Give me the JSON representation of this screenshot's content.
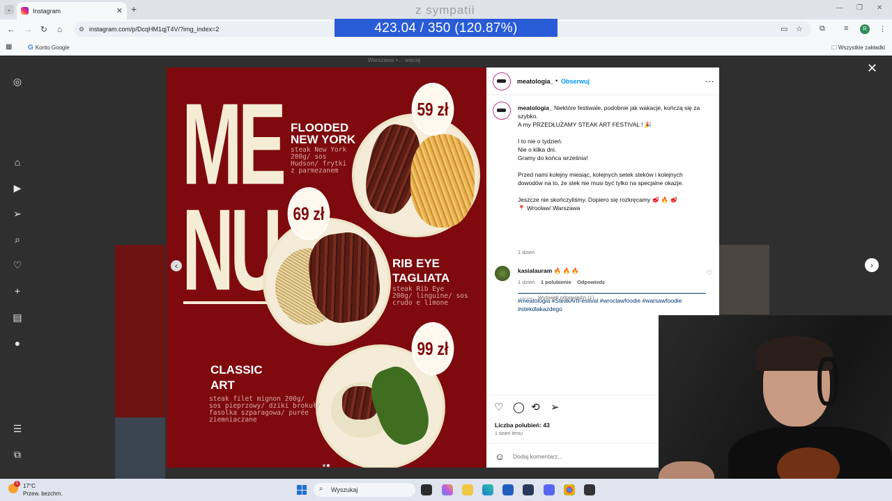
{
  "browser": {
    "tab_title": "Instagram",
    "tab_close": "✕",
    "new_tab": "+",
    "url": "instagram.com/p/DcqHM1qjT4V/?img_index=2",
    "bookmark_google": "Konto Google",
    "bookmark_all": "Wszystkie zakładki",
    "profile_initial": "R"
  },
  "overlay": {
    "caption": "z sympatii",
    "score": "423.04 / 350 (120.87%)"
  },
  "background_post": {
    "location": "Warszawa +... więcej"
  },
  "post_image": {
    "menu_line1": "ME",
    "menu_line2": "NU",
    "dishes": [
      {
        "name_line1": "FLOODED",
        "name_line2": "NEW YORK",
        "desc": "steak New York\n200g/ sos\nHudson/ frytki\nz parmezanem",
        "price": "59 zł"
      },
      {
        "name_line1": "RIB EYE",
        "name_line2": "TAGLIATA",
        "desc": "steak Rib Eye\n200g/ linguine/ sos\ncrudo e limone",
        "price": "69 zł"
      },
      {
        "name_line1": "CLASSIC",
        "name_line2": "ART",
        "desc": "steak filet mignon 200g/\nsos pieprzowy/ dziki brokuł/\nfasolka szparagowa/ purée\nziemniaczane",
        "price": "99 zł"
      }
    ]
  },
  "post": {
    "username": "meatologia_",
    "follow": "Obserwuj",
    "caption_user": "meatologia_",
    "caption_text": "Niektóre festiwale, podobnie jak wakacje, kończą się za szybko.\nA my PRZEDŁUŻAMY STEAK ART FESTIVAL ! 🎉\n\nI to nie o tydzień.\nNie o kilka dni.\nGramy do końca września!\n\nPrzed nami kolejny miesiąc, kolejnych setek steków i kolejnych dowodów na to, że stek nie musi być tylko na specjalne okazje.\n\nJeszcze nie skończyliśmy. Dopiero się rozkręcamy 🥩 🔥 🥩\n📍 Wrocław/ Warszawa",
    "hashtags": "#meatologia #SteakArtFestival #wroclawfoodie #warsawfoodie #stekdlakazdego",
    "caption_age": "1 dzień",
    "comment": {
      "user": "kasialauram",
      "text": "🔥 🔥 🔥",
      "age": "1 dzień",
      "likes": "1 polubienie",
      "reply": "Odpowiedz",
      "view_replies": "Wyświetl odpowiedzi (1)"
    },
    "likes": "Liczba polubień: 43",
    "posted": "1 dzień temu",
    "comment_placeholder": "Dodaj komentarz..."
  },
  "taskbar": {
    "temperature": "17°C",
    "weather": "Przew. bezchm.",
    "weather_badge": "1",
    "search": "Wyszukaj"
  },
  "colors": {
    "menu_bg": "#7e0a0e",
    "accent_blue": "#0095f6",
    "score_bg": "#2a5bd7"
  },
  "icons": [
    "instagram-icon",
    "home-icon",
    "reels-icon",
    "send-icon",
    "search-icon",
    "heart-icon",
    "plus-icon",
    "insights-icon",
    "more-icon",
    "apps-icon"
  ]
}
